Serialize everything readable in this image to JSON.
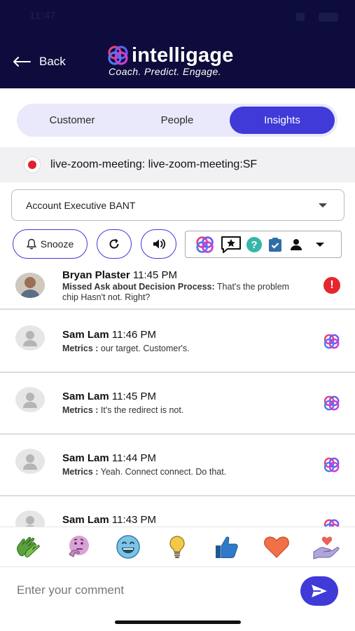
{
  "status_bar": {
    "time": "11:47"
  },
  "header": {
    "back_label": "Back",
    "brand_name": "intelligage",
    "tagline": "Coach. Predict. Engage."
  },
  "tabs": [
    {
      "label": "Customer",
      "active": false
    },
    {
      "label": "People",
      "active": false
    },
    {
      "label": "Insights",
      "active": true
    }
  ],
  "meeting": {
    "title": "live-zoom-meeting: live-zoom-meeting:SF"
  },
  "playbook_select": {
    "value": "Account Executive BANT"
  },
  "actions": {
    "snooze_label": "Snooze"
  },
  "feed": [
    {
      "name": "Bryan Plaster",
      "time": "11:45 PM",
      "label": "Missed Ask about Decision Process:",
      "text": "That's the problem chip Hasn't not. Right?",
      "icon": "alert-icon"
    },
    {
      "name": "Sam Lam",
      "time": "11:46 PM",
      "label": "Metrics :",
      "text": "our target. Customer's.",
      "icon": "intelligage-logo-icon"
    },
    {
      "name": "Sam Lam",
      "time": "11:45 PM",
      "label": "Metrics :",
      "text": "It's the redirect is not.",
      "icon": "intelligage-logo-icon"
    },
    {
      "name": "Sam Lam",
      "time": "11:44 PM",
      "label": "Metrics :",
      "text": "Yeah. Connect connect. Do that.",
      "icon": "intelligage-logo-icon"
    },
    {
      "name": "Sam Lam",
      "time": "11:43 PM",
      "label": "",
      "text": "",
      "icon": "intelligage-logo-icon"
    }
  ],
  "reactions": [
    "clapping-hands",
    "thinking-face",
    "grinning-face",
    "light-bulb",
    "thumbs-up",
    "heart",
    "heart-in-hand"
  ],
  "comment": {
    "placeholder": "Enter your comment"
  },
  "colors": {
    "header_bg": "#0d0c3c",
    "accent": "#3f3ad8",
    "alert": "#e5262e"
  }
}
